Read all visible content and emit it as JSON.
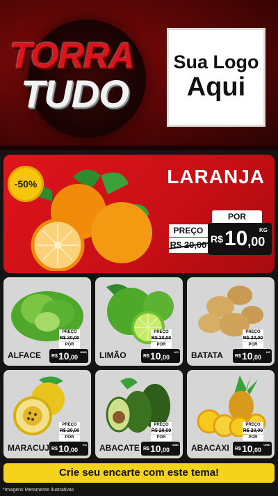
{
  "header": {
    "brand_line1": "TORRA",
    "brand_line2": "TUDO",
    "logo_line1": "Sua Logo",
    "logo_line2": "Aqui"
  },
  "featured": {
    "name": "LARANJA",
    "discount": "-50%",
    "por_label": "POR",
    "preco_label": "PREÇO",
    "old_price": "R$ 20,00",
    "currency": "R$",
    "price_int": "10",
    "price_dec": ",00",
    "unit": "KG"
  },
  "products": [
    {
      "name": "ALFACE",
      "preco_label": "PREÇO",
      "old_price": "R$ 20,00",
      "por_label": "POR",
      "currency": "R$",
      "price_int": "10",
      "price_dec": ",00",
      "unit": "UNID"
    },
    {
      "name": "LIMÃO",
      "preco_label": "PREÇO",
      "old_price": "R$ 20,00",
      "por_label": "POR",
      "currency": "R$",
      "price_int": "10",
      "price_dec": ",00",
      "unit": "KG"
    },
    {
      "name": "BATATA",
      "preco_label": "PREÇO",
      "old_price": "R$ 20,00",
      "por_label": "POR",
      "currency": "R$",
      "price_int": "10",
      "price_dec": ",00",
      "unit": "KG"
    },
    {
      "name": "MARACUJÁ",
      "preco_label": "PREÇO",
      "old_price": "R$ 20,00",
      "por_label": "POR",
      "currency": "R$",
      "price_int": "10",
      "price_dec": ",00",
      "unit": "KG"
    },
    {
      "name": "ABACATE",
      "preco_label": "PREÇO",
      "old_price": "R$ 20,00",
      "por_label": "POR",
      "currency": "R$",
      "price_int": "10",
      "price_dec": ",00",
      "unit": "UNID"
    },
    {
      "name": "ABACAXI",
      "preco_label": "PREÇO",
      "old_price": "R$ 20,00",
      "por_label": "POR",
      "currency": "R$",
      "price_int": "10",
      "price_dec": ",00",
      "unit": "UNID"
    }
  ],
  "cta": "Crie seu encarte com este tema!",
  "footnote": "*Imagens Meramente Ilustrativas",
  "colors": {
    "brand_red": "#d3131a",
    "accent_yellow": "#f5d31a",
    "card_gray": "#d6d6d6"
  }
}
